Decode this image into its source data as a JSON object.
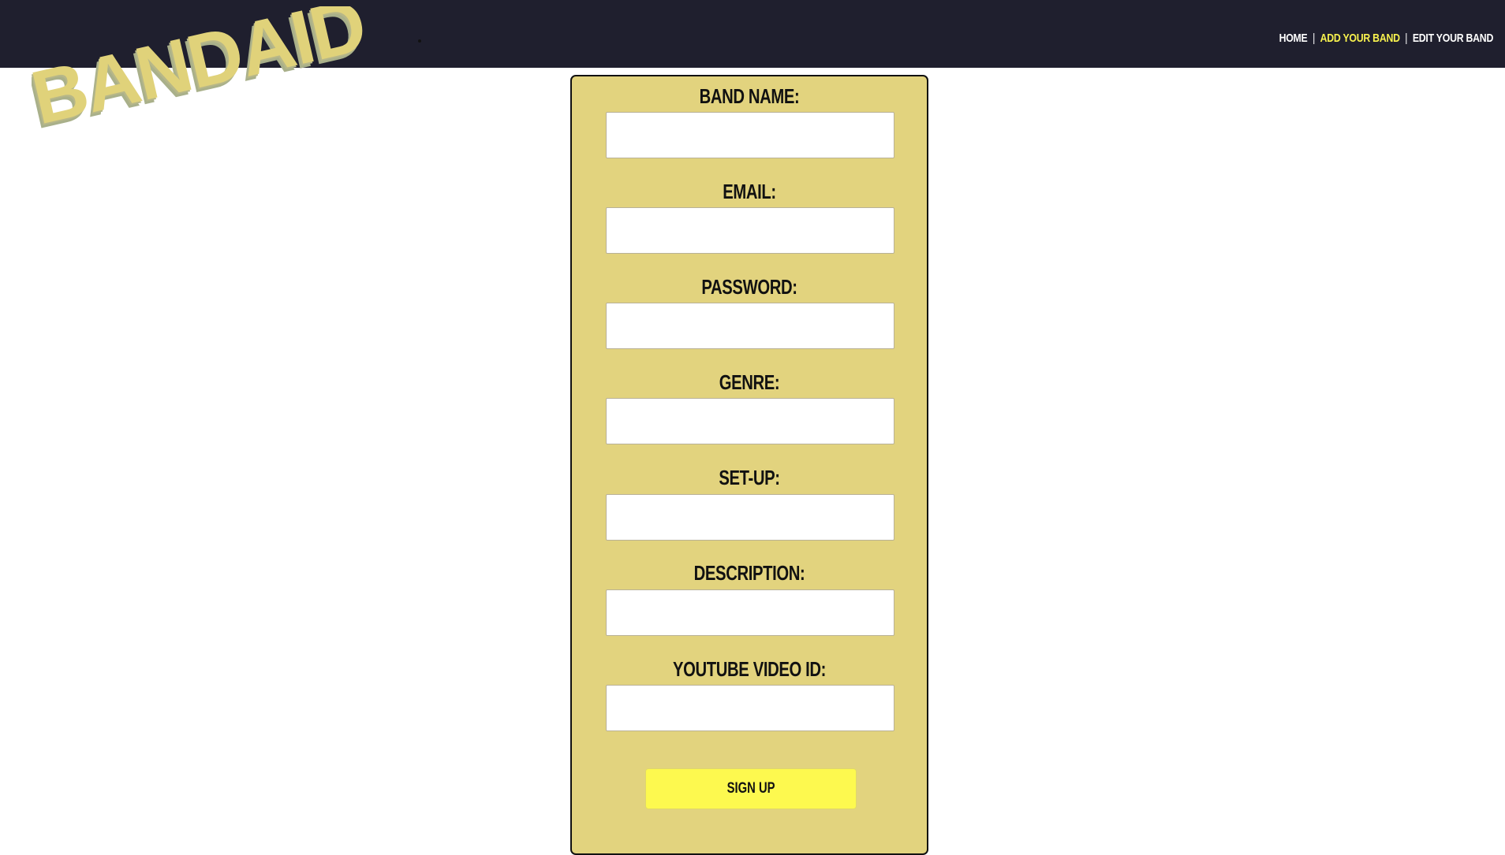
{
  "header": {
    "logo_text": "BANDAID",
    "logo_colors": {
      "face": "#e0d27a",
      "side": "#a9b08a"
    },
    "nav": [
      {
        "label": "HOME",
        "active": false
      },
      {
        "label": "ADD YOUR BAND",
        "active": true
      },
      {
        "label": "EDIT YOUR BAND",
        "active": false
      }
    ],
    "nav_separator": "|"
  },
  "form": {
    "fields": [
      {
        "label": "BAND NAME:",
        "value": "",
        "placeholder": ""
      },
      {
        "label": "EMAIL:",
        "value": "",
        "placeholder": ""
      },
      {
        "label": "PASSWORD:",
        "value": "",
        "placeholder": ""
      },
      {
        "label": "GENRE:",
        "value": "",
        "placeholder": ""
      },
      {
        "label": "SET-UP:",
        "value": "",
        "placeholder": ""
      },
      {
        "label": "DESCRIPTION:",
        "value": "",
        "placeholder": ""
      },
      {
        "label": "YOUTUBE VIDEO ID:",
        "value": "",
        "placeholder": ""
      }
    ],
    "submit_label": "SIGN UP"
  },
  "colors": {
    "header_bg": "#1f1f2e",
    "panel_bg": "#e2d37e",
    "nav_active": "#f8f24e",
    "button_bg": "#fdf94f"
  }
}
